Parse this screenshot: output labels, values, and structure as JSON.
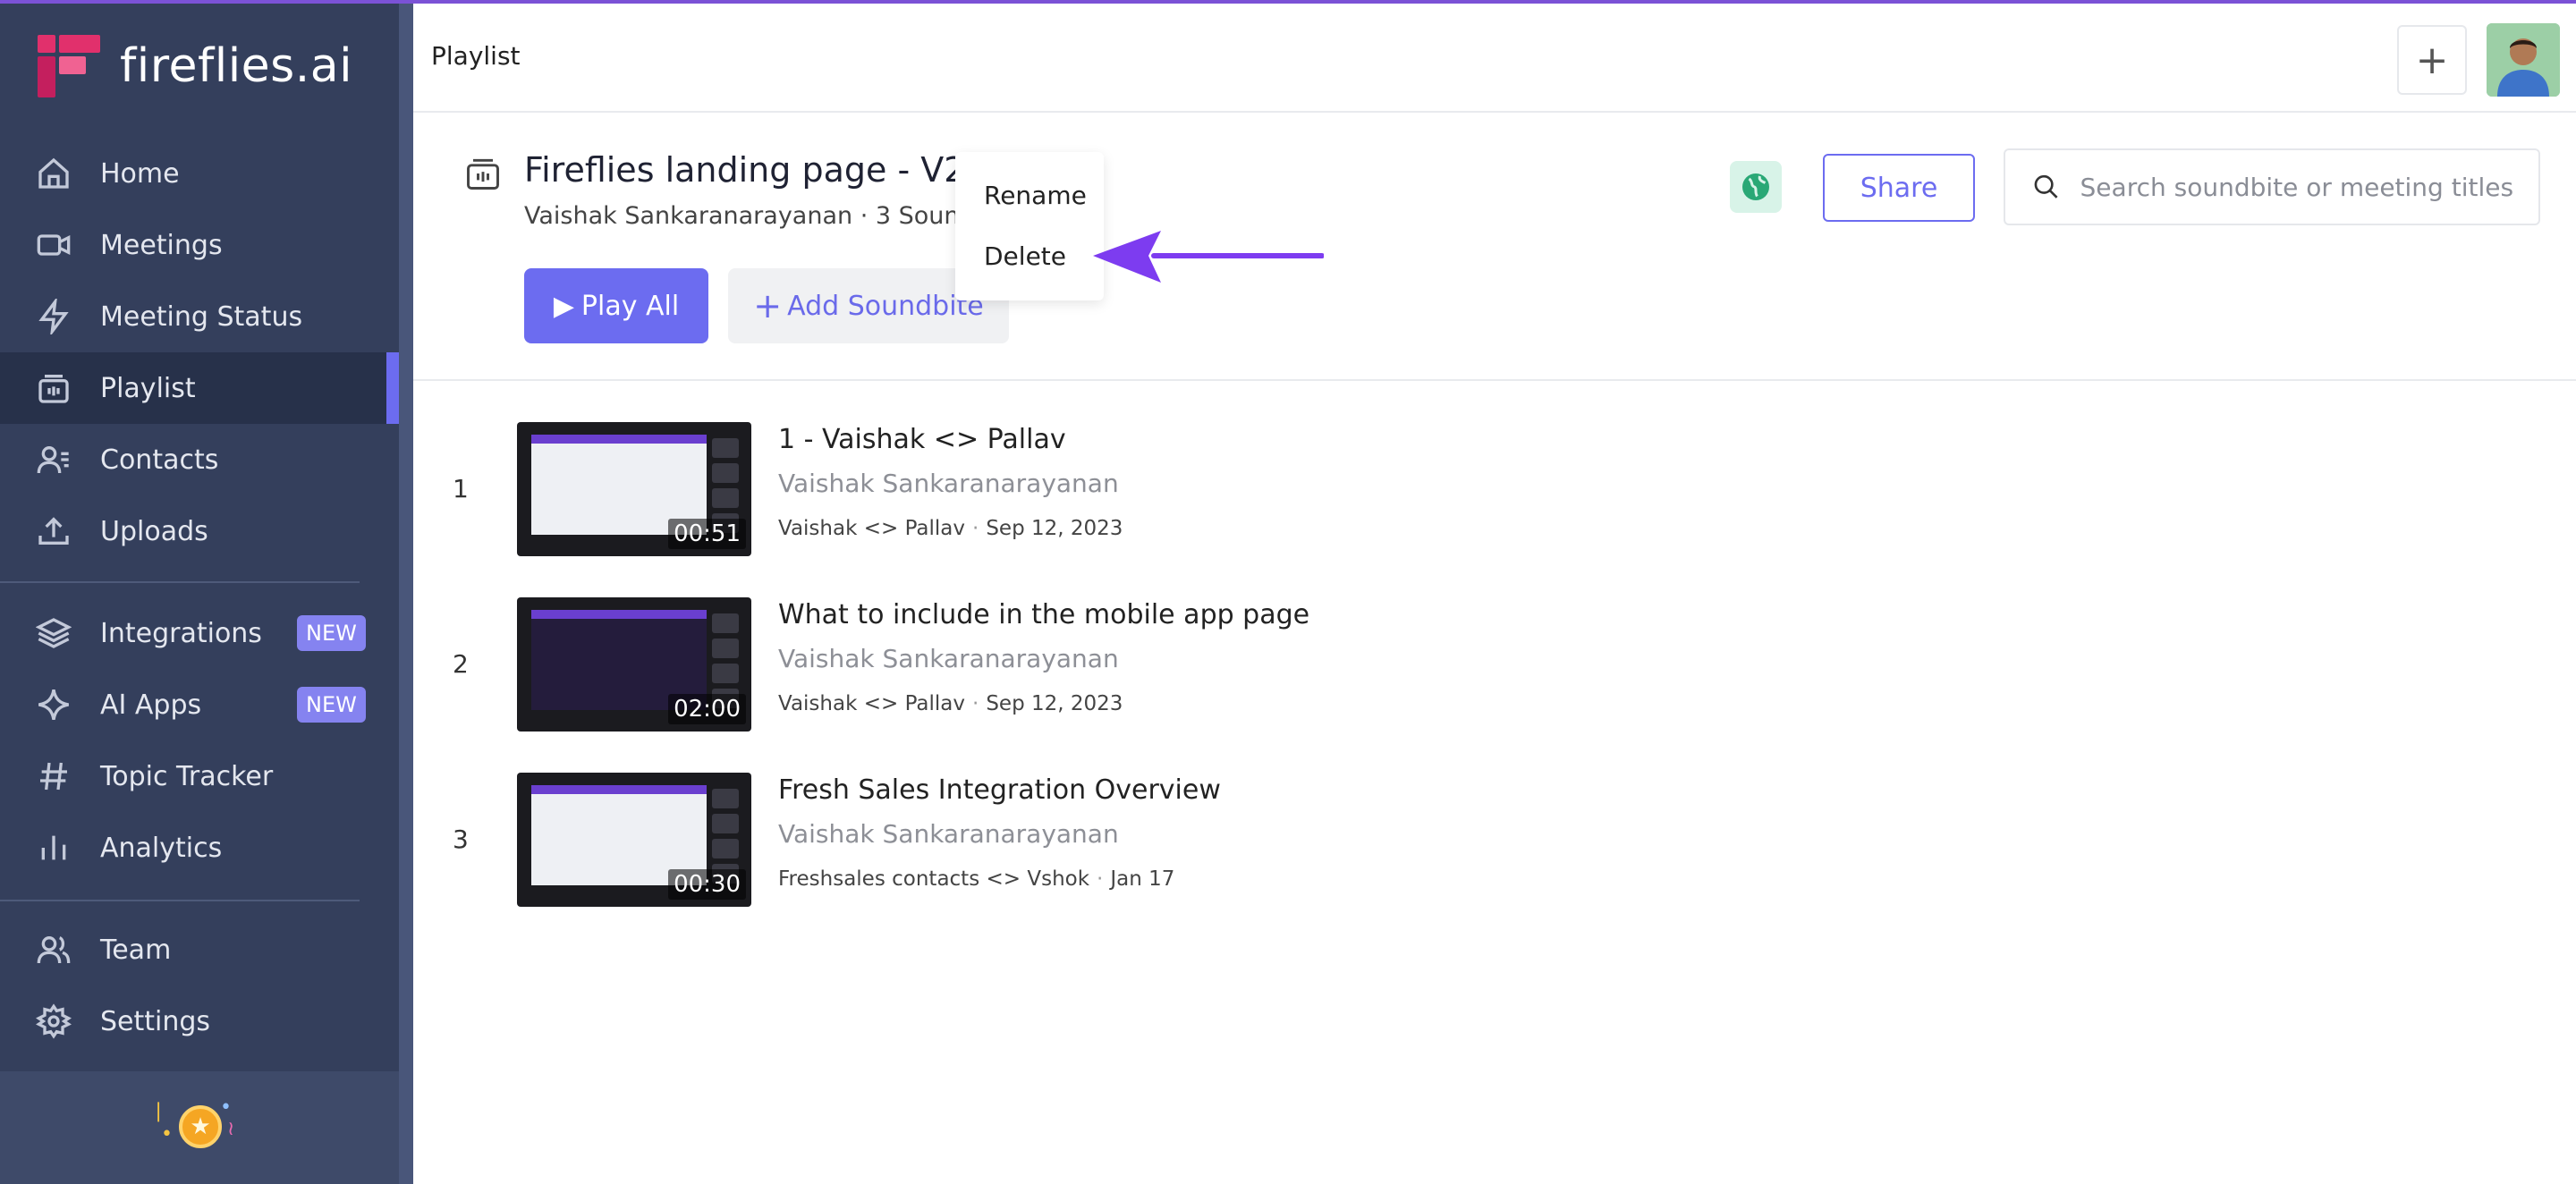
{
  "brand": {
    "name": "fireflies.ai",
    "primary": "#6c6cf0",
    "sidebar_bg": "#343f5c",
    "logo_pink": "#e1306c"
  },
  "sidebar": {
    "items": [
      {
        "label": "Home",
        "icon": "home-icon"
      },
      {
        "label": "Meetings",
        "icon": "video-icon"
      },
      {
        "label": "Meeting Status",
        "icon": "lightning-icon"
      },
      {
        "label": "Playlist",
        "icon": "playlist-icon",
        "active": true
      },
      {
        "label": "Contacts",
        "icon": "contacts-icon"
      },
      {
        "label": "Uploads",
        "icon": "upload-icon"
      },
      {
        "label": "Integrations",
        "icon": "layers-icon",
        "badge": "NEW"
      },
      {
        "label": "AI Apps",
        "icon": "sparkle-icon",
        "badge": "NEW"
      },
      {
        "label": "Topic Tracker",
        "icon": "hash-icon"
      },
      {
        "label": "Analytics",
        "icon": "bar-chart-icon"
      },
      {
        "label": "Team",
        "icon": "team-icon"
      },
      {
        "label": "Settings",
        "icon": "gear-icon"
      }
    ]
  },
  "header": {
    "title": "Playlist",
    "add_icon": "plus-icon"
  },
  "playlist": {
    "title": "Fireflies landing page - V2",
    "subtitle": "Vaishak Sankaranarayanan · 3 Soundb",
    "play_all": "Play All",
    "add_soundbite": "Add Soundbite",
    "share": "Share",
    "search_placeholder": "Search soundbite or meeting titles"
  },
  "menu": {
    "rename": "Rename",
    "delete": "Delete"
  },
  "soundbites": [
    {
      "index": "1",
      "title": "1 - Vaishak <> Pallav",
      "author": "Vaishak Sankaranarayanan",
      "meeting": "Vaishak <> Pallav",
      "date": "Sep 12, 2023",
      "duration": "00:51"
    },
    {
      "index": "2",
      "title": "What to include in the mobile app page",
      "author": "Vaishak Sankaranarayanan",
      "meeting": "Vaishak <> Pallav",
      "date": "Sep 12, 2023",
      "duration": "02:00"
    },
    {
      "index": "3",
      "title": "Fresh Sales Integration Overview",
      "author": "Vaishak Sankaranarayanan",
      "meeting": "Freshsales contacts <> Vshok",
      "date": "Jan 17",
      "duration": "00:30"
    }
  ]
}
